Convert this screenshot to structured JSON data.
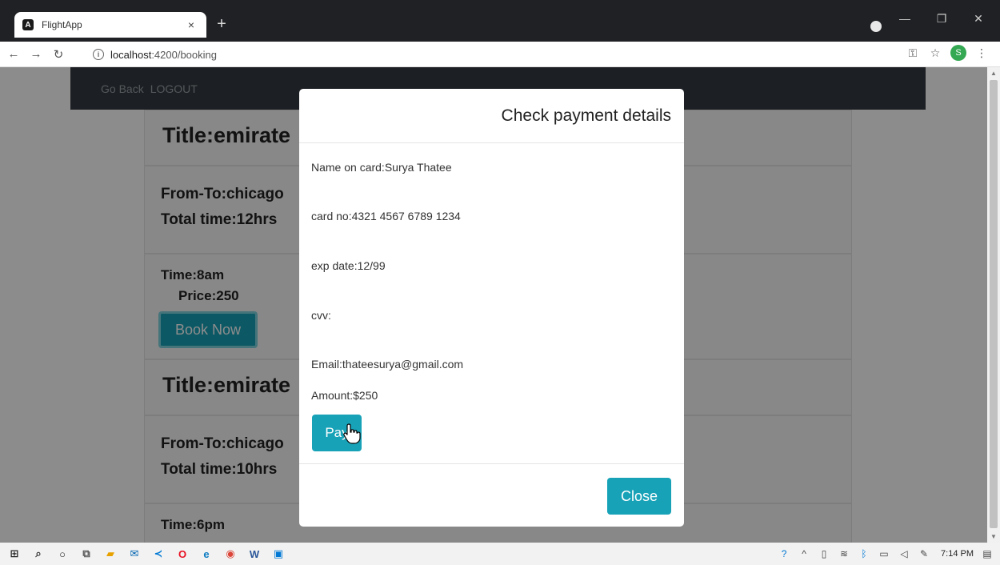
{
  "browser": {
    "tab_title": "FlightApp",
    "tab_close": "×",
    "new_tab": "+",
    "url_host": "localhost",
    "url_path": ":4200/booking",
    "avatar_letter": "S"
  },
  "navbar": {
    "go_back": "Go Back",
    "logout": "LOGOUT"
  },
  "flights": [
    {
      "title": "Title:emirate",
      "route": "From-To:chicago",
      "total_time": "Total time:12hrs",
      "time": "Time:8am",
      "price": "Price:250",
      "book_label": "Book Now"
    },
    {
      "title": "Title:emirate",
      "route": "From-To:chicago",
      "total_time": "Total time:10hrs",
      "time": "Time:6pm"
    }
  ],
  "modal": {
    "title": "Check payment details",
    "name_on_card": "Name on card:Surya Thatee",
    "card_no": "card no:4321 4567 6789 1234",
    "exp_date": "exp date:12/99",
    "cvv": "cvv:",
    "email": "Email:thateesurya@gmail.com",
    "amount": "Amount:$250",
    "pay_label": "Pay",
    "close_label": "Close"
  },
  "taskbar": {
    "clock": "7:14 PM"
  },
  "colors": {
    "accent": "#17a2b8",
    "navbar": "#343a40",
    "chrome": "#202124"
  }
}
